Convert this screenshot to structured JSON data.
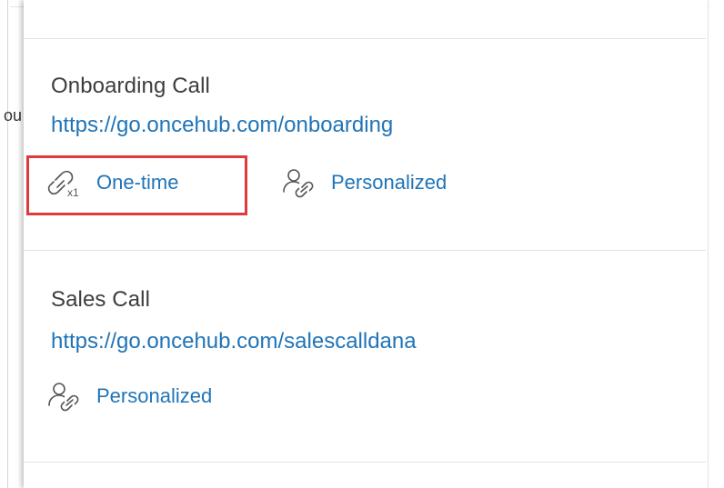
{
  "background_fragment": "ou",
  "cards": [
    {
      "title": "Onboarding Call",
      "url": "https://go.oncehub.com/onboarding",
      "links": [
        {
          "icon": "one-time-link-icon",
          "label": "One-time"
        },
        {
          "icon": "personalized-link-icon",
          "label": "Personalized"
        }
      ]
    },
    {
      "title": "Sales Call",
      "url": "https://go.oncehub.com/salescalldana",
      "links": [
        {
          "icon": "personalized-link-icon",
          "label": "Personalized"
        }
      ]
    }
  ],
  "colors": {
    "link": "#1f74b8",
    "title": "#3d3d3d",
    "highlight": "#e03a3e",
    "icon_stroke": "#555555"
  }
}
